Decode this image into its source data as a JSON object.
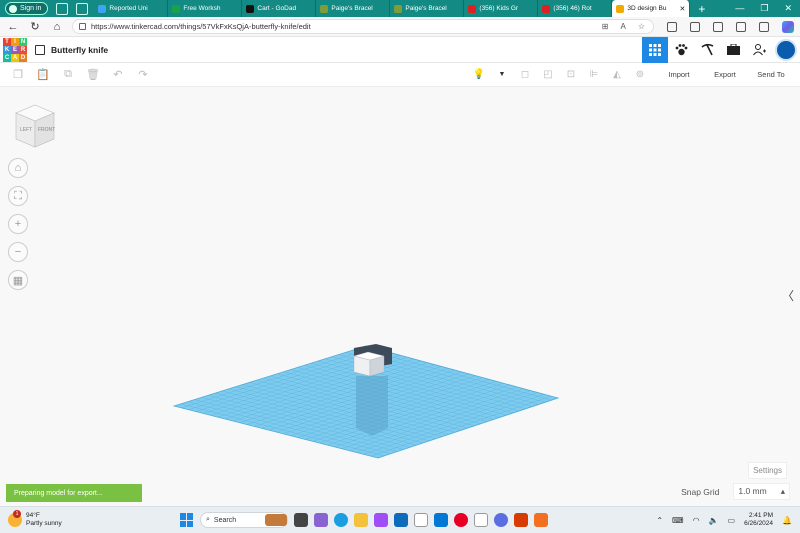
{
  "browser": {
    "signin_label": "Sign in",
    "tabs": [
      {
        "label": "Reported Uni",
        "favicon_color": "#3fa4f5"
      },
      {
        "label": "Free Worksh",
        "favicon_color": "#16a34a"
      },
      {
        "label": "Cart - GoDad",
        "favicon_color": "#111111"
      },
      {
        "label": "Paige's Bracel",
        "favicon_color": "#7f9c3a"
      },
      {
        "label": "Paige's Bracel",
        "favicon_color": "#7f9c3a"
      },
      {
        "label": "(356) Kids Gr",
        "favicon_color": "#e02020"
      },
      {
        "label": "(356) 46) Rot",
        "favicon_color": "#e02020"
      },
      {
        "label": "3D design Bu",
        "favicon_color": "#f2a900",
        "active": true
      }
    ],
    "url": "https://www.tinkercad.com/things/57VkFxKsQjA-butterfly-knife/edit",
    "window_controls": [
      "—",
      "❐",
      "✕"
    ]
  },
  "app": {
    "logo_letters": [
      "TIN",
      "KER",
      "CAD"
    ],
    "logo_colors": [
      "#e8412c",
      "#f39c12",
      "#2ecc71",
      "#3498db",
      "#9b59b6",
      "#e74c3c",
      "#1abc9c",
      "#f1c40f",
      "#e67e22"
    ],
    "design_title": "Butterfly knife",
    "accent_color": "#1e88e5"
  },
  "toolbar": {
    "import_label": "Import",
    "export_label": "Export",
    "send_to_label": "Send To"
  },
  "workplane": {
    "viewcube_left": "LEFT",
    "viewcube_front": "FRONT",
    "grid_color": "#6fc3ea",
    "settings_label": "Settings",
    "snap_grid_label": "Snap Grid",
    "snap_grid_value": "1.0 mm",
    "toast": "Preparing model for export..."
  },
  "taskbar": {
    "temperature": "94°F",
    "weather": "Partly sunny",
    "weather_badge": "1",
    "search_label": "Search",
    "time": "2:41 PM",
    "date": "6/26/2024"
  }
}
